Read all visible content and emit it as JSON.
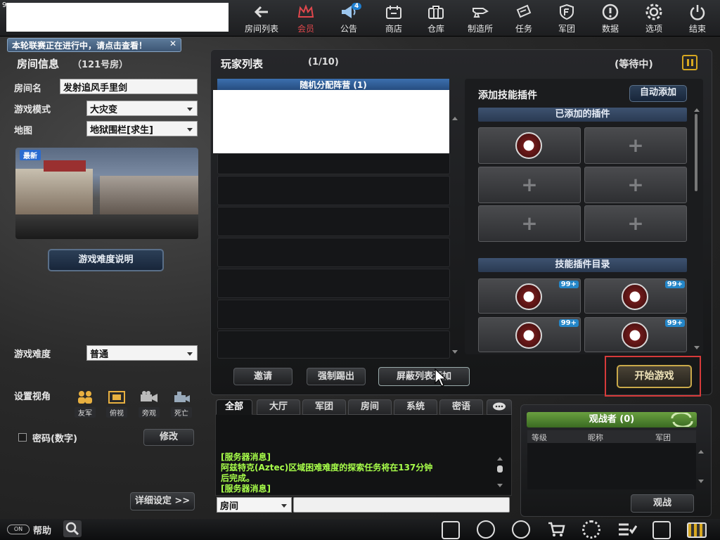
{
  "corner_digit": "9",
  "top_nav": [
    {
      "label": "房间列表",
      "icon": "back-arrow-icon"
    },
    {
      "label": "会员",
      "icon": "crown-icon"
    },
    {
      "label": "公告",
      "icon": "megaphone-icon",
      "badge": "4"
    },
    {
      "label": "商店",
      "icon": "shop-icon"
    },
    {
      "label": "仓库",
      "icon": "briefcase-icon"
    },
    {
      "label": "制造所",
      "icon": "anvil-icon"
    },
    {
      "label": "任务",
      "icon": "mission-icon"
    },
    {
      "label": "军团",
      "icon": "shield-icon"
    },
    {
      "label": "数据",
      "icon": "info-icon"
    },
    {
      "label": "选项",
      "icon": "gear-icon"
    },
    {
      "label": "结束",
      "icon": "power-icon"
    }
  ],
  "notice": {
    "text": "本轮联赛正在进行中，请点击查看！",
    "close": "✕"
  },
  "room": {
    "title": "房间信息",
    "room_no": "（121号房）",
    "name_label": "房间名",
    "name_value": "发射追风手里剑",
    "mode_label": "游戏模式",
    "mode_value": "大灾变",
    "map_label": "地图",
    "map_value": "地狱围栏[求生]",
    "new_badge": "最新",
    "difficulty_info_button": "游戏难度说明",
    "difficulty_label": "游戏难度",
    "difficulty_value": "普通",
    "view_label": "设置视角",
    "views": [
      {
        "label": "友军",
        "icon": "allies-icon"
      },
      {
        "label": "俯视",
        "icon": "overhead-icon"
      },
      {
        "label": "旁观",
        "icon": "camera-icon"
      },
      {
        "label": "死亡",
        "icon": "video-camera-icon"
      }
    ],
    "password_label": "密码(数字)",
    "modify_button": "修改",
    "detail_button": "详细设定 >>"
  },
  "players": {
    "title": "玩家列表",
    "count": "(1/10)",
    "status": "(等待中)",
    "team_header": "随机分配阵营 (1)",
    "invite_button": "邀请",
    "kick_button": "强制踢出",
    "block_button": "屏蔽列表添加"
  },
  "plugins": {
    "title": "添加技能插件",
    "auto_button": "自动添加",
    "added_header": "已添加的插件",
    "catalog_header": "技能插件目录",
    "badge": "99+"
  },
  "start_button": "开始游戏",
  "chat": {
    "tabs": [
      "全部",
      "大厅",
      "军团",
      "房间",
      "系统",
      "密语"
    ],
    "messages": [
      "[服务器消息]",
      "阿兹特克(Aztec)区域困难难度的探索任务将在137分钟",
      "后完成。",
      "[服务器消息]"
    ],
    "channel": "房间",
    "input_value": ""
  },
  "spectators": {
    "title": "观战者 (0)",
    "cols": [
      "等级",
      "昵称",
      "军团"
    ],
    "watch_button": "观战"
  },
  "bottom": {
    "help_label": "帮助",
    "toggle_label": "ON"
  },
  "colors": {
    "vip": "#e0474c",
    "chat": "#a8ff4a",
    "highlight": "#d63a3a",
    "accent_blue": "#2486c8"
  }
}
